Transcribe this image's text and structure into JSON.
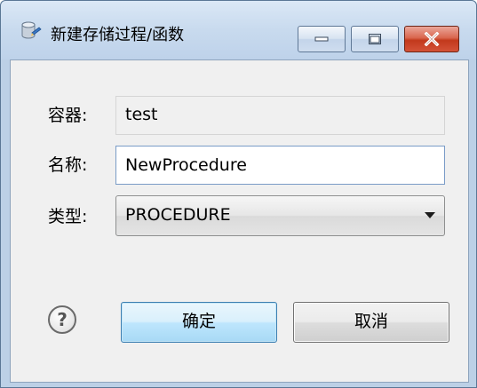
{
  "window": {
    "title": "新建存储过程/函数",
    "icon": "database-procedure-icon",
    "controls": [
      "minimize",
      "maximize",
      "close"
    ]
  },
  "form": {
    "container_label": "容器:",
    "container_value": "test",
    "name_label": "名称:",
    "name_value": "NewProcedure",
    "type_label": "类型:",
    "type_value": "PROCEDURE"
  },
  "buttons": {
    "help": "?",
    "ok": "确定",
    "cancel": "取消"
  },
  "colors": {
    "close_button": "#c2391c",
    "ok_button_border": "#3c7fb1",
    "input_border": "#7a9cc7"
  }
}
